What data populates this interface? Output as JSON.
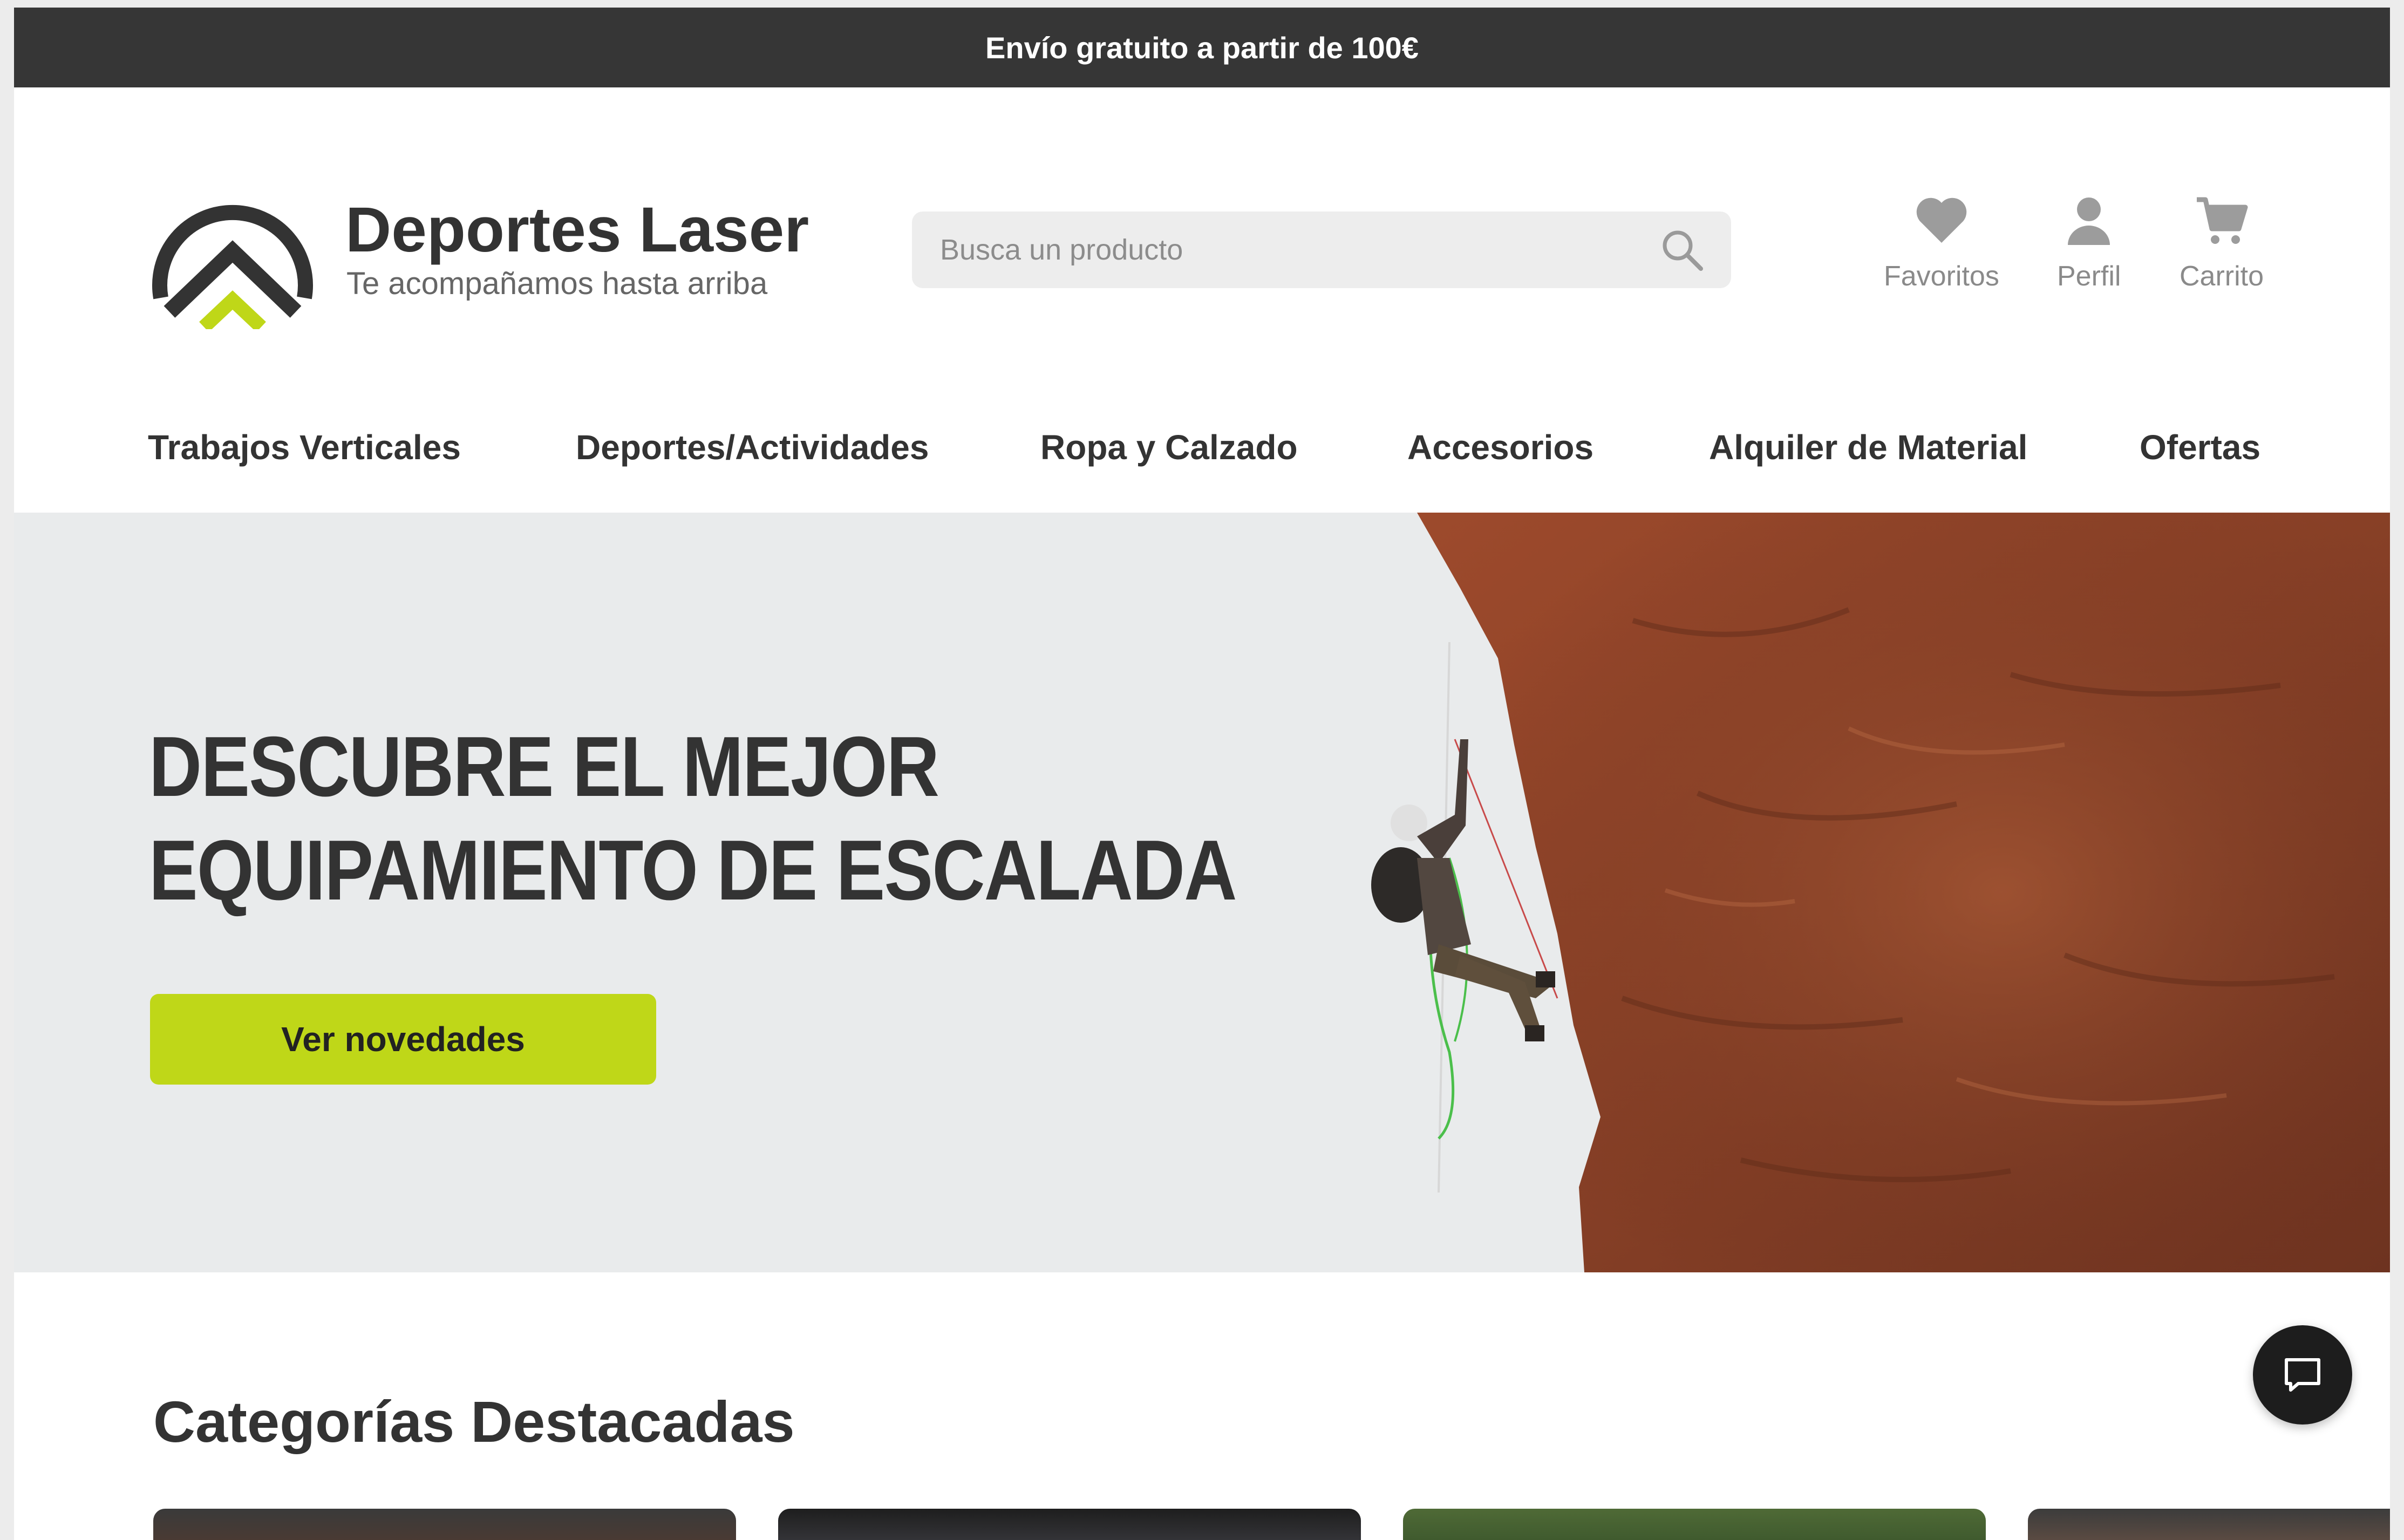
{
  "topbar": {
    "text": "Envío gratuito a partir de 100€"
  },
  "brand": {
    "name": "Deportes Laser",
    "tagline": "Te acompañamos hasta arriba",
    "logo_icon": "mountain-peak-logo",
    "colors": {
      "dark": "#333333",
      "accent": "#bfd718"
    }
  },
  "search": {
    "placeholder": "Busca un producto",
    "value": "",
    "icon": "search-icon"
  },
  "header_actions": [
    {
      "label": "Favoritos",
      "icon": "heart-icon"
    },
    {
      "label": "Perfil",
      "icon": "user-icon"
    },
    {
      "label": "Carrito",
      "icon": "cart-icon"
    }
  ],
  "nav": [
    {
      "label": "Trabajos Verticales"
    },
    {
      "label": "Deportes/Actividades"
    },
    {
      "label": "Ropa y Calzado"
    },
    {
      "label": "Accesorios"
    },
    {
      "label": "Alquiler de Material"
    },
    {
      "label": "Ofertas"
    }
  ],
  "hero": {
    "title_line1": "DESCUBRE EL MEJOR",
    "title_line2": "EQUIPAMIENTO DE ESCALADA",
    "cta": "Ver novedades",
    "image": "climber-on-red-rock-face"
  },
  "featured": {
    "title": "Categorías Destacadas",
    "cards": [
      "category-card-1",
      "category-card-2",
      "category-card-3",
      "category-card-4"
    ]
  },
  "chat": {
    "icon": "chat-bubble-icon"
  },
  "colors": {
    "topbar_bg": "#363636",
    "hero_bg": "#e9ebec",
    "cta_bg": "#bfd718",
    "search_bg": "#ededed"
  }
}
